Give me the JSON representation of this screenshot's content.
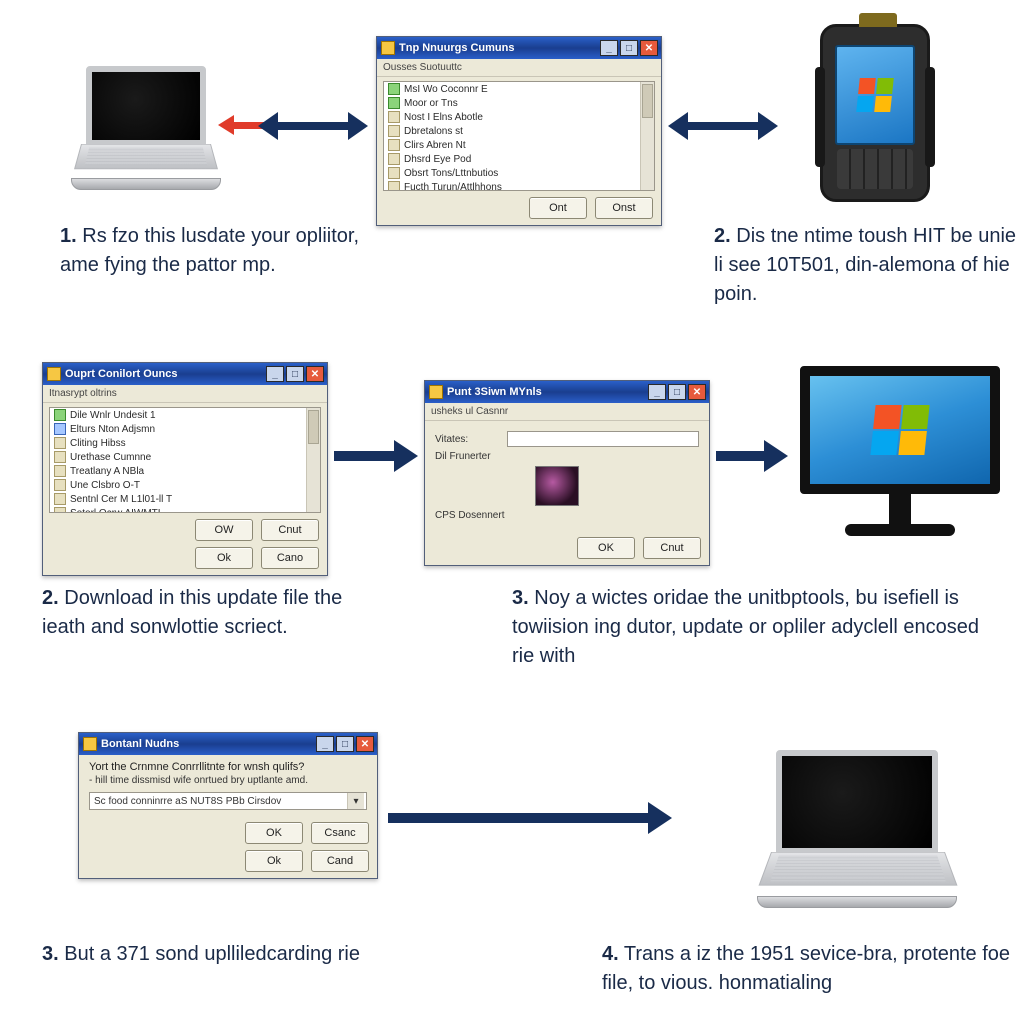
{
  "topDialog": {
    "title": "Tnp Nnuurgs Cumuns",
    "subhead": "Ousses Suotuuttc",
    "items": [
      "MsI Wo Coconnr E",
      "Moor or Tns",
      "Nost I Elns Abotle",
      "Dbretalons st",
      "Clirs Abren Nt",
      "Dhsrd Eye Pod",
      "Obsrt Tons/Lttnbutios",
      "Fucth Turun/Attlhhons"
    ],
    "btn1": "Ont",
    "btn2": "Onst"
  },
  "leftDialog": {
    "title": "Ouprt Conilort Ouncs",
    "subhead": "Itnasrypt oltrins",
    "items": [
      "Dile Wnlr Undesit 1",
      "Elturs Nton Adjsmn",
      "Cliting Hibss",
      "Urethase Cumnne",
      "Treatlany A NBla",
      "Une Clsbro O-T",
      "Sentnl Cer M L1l01-ll T",
      "Sotorl Ocrw AIWMTI"
    ],
    "btn1a": "OW",
    "btn2a": "Cnut",
    "btn1b": "Ok",
    "btn2b": "Cano"
  },
  "midDialog": {
    "title": "Punt 3Siwn MYnls",
    "subhead": "usheks ul Casnnr",
    "label1": "Vitates:",
    "label2": "Dil Frunerter",
    "label3": "CPS Dosennert",
    "btn1": "OK",
    "btn2": "Cnut"
  },
  "botDialog": {
    "title": "Bontanl Nudns",
    "question": "Yort the Crnmne Conrrllitnte for wnsh qulifs?",
    "sub": "- hill time dissmisd wife onrtued bry uptlante amd.",
    "combo": "Sc food conninrre aS NUT8S PBb Cirsdov",
    "btn1a": "OK",
    "btn2a": "Csanc",
    "btn1b": "Ok",
    "btn2b": "Cand"
  },
  "cap1": {
    "num": "1.",
    "text": "Rs fzo this lusdate your opliitor, ame fying the pattor mp."
  },
  "cap2": {
    "num": "2.",
    "text": "Dis tne ntime toush HIT be unie li see 10T501, din-alemona of hie poin."
  },
  "cap3": {
    "num": "2.",
    "text": "Download in this update file the ieath and sonwlottie scriect."
  },
  "cap4": {
    "num": "3.",
    "text": "Noy a wictes oridae the unitbptools, bu isefiell is towiision ing dutor, update or opliler adyclell encosed rie with"
  },
  "cap5": {
    "num": "3.",
    "text": "But a 371 sond uplliledcarding rie"
  },
  "cap6": {
    "num": "4.",
    "text": "Trans a iz the 1951 sevice-bra, protente foe file, to vious. honmatialing"
  }
}
